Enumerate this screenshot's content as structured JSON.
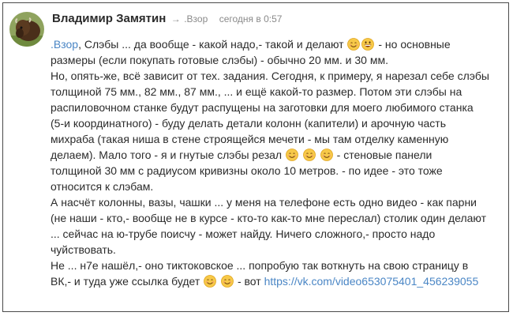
{
  "comment": {
    "author": "Владимир Замятин",
    "arrow": "→",
    "reply_to": ".Взор",
    "time": "сегодня в 0:57"
  },
  "icons": {
    "avatar": "bison-avatar",
    "emoji_smile": "smiling-face-emoji",
    "emoji_grin": "grinning-face-emoji"
  },
  "colors": {
    "link": "#4a86c5",
    "text": "#2b2b2b",
    "meta": "#8a8a8a"
  },
  "text": {
    "l1_mention": ".Взор",
    "l1_a": ", Слэбы ... да вообще - какой надо,- такой и делают",
    "l1_b": "- но основные",
    "l2": "размеры (если покупать готовые слэбы) - обычно 20 мм. и 30 мм.",
    "l3": "Но, опять-же, всё зависит от тех. задания. Сегодня, к примеру, я нарезал себе слэбы",
    "l4": "толщиной 75 мм., 82 мм., 87 мм., ... и ещё какой-то размер. Потом эти слэбы на",
    "l5": "распиловочном станке будут распущены на заготовки для моего любимого станка",
    "l6": "(5-и координатного) - буду делать детали колонн (капители) и арочную часть",
    "l7": "михраба (такая ниша в стене строящейся мечети - мы там отделку каменную",
    "l8_a": "делаем). Мало того - я и гнутые слэбы резал",
    "l8_b": "- стеновые панели",
    "l9": "толщиной 30 мм с радиусом кривизны около 10 метров. - по идее - это тоже",
    "l10": "относится к слэбам.",
    "l11": "А насчёт колонны, вазы, чашки ... у меня на телефоне есть одно видео - как парни",
    "l12": "(не наши - кто,- вообще не в курсе - кто-то как-то мне переслал) столик один делают",
    "l13": "... сейчас на ю-трубе поисчу - может найду. Ничего сложного,- просто надо",
    "l14": "чуйствовать.",
    "l15": "Не ... н7е нашёл,- оно тиктоковское ... попробую так воткнуть на свою страницу в",
    "l16_a": "ВК,- и туда уже ссылка будет",
    "l16_b": "- вот",
    "link": "https://vk.com/video653075401_456239055"
  }
}
